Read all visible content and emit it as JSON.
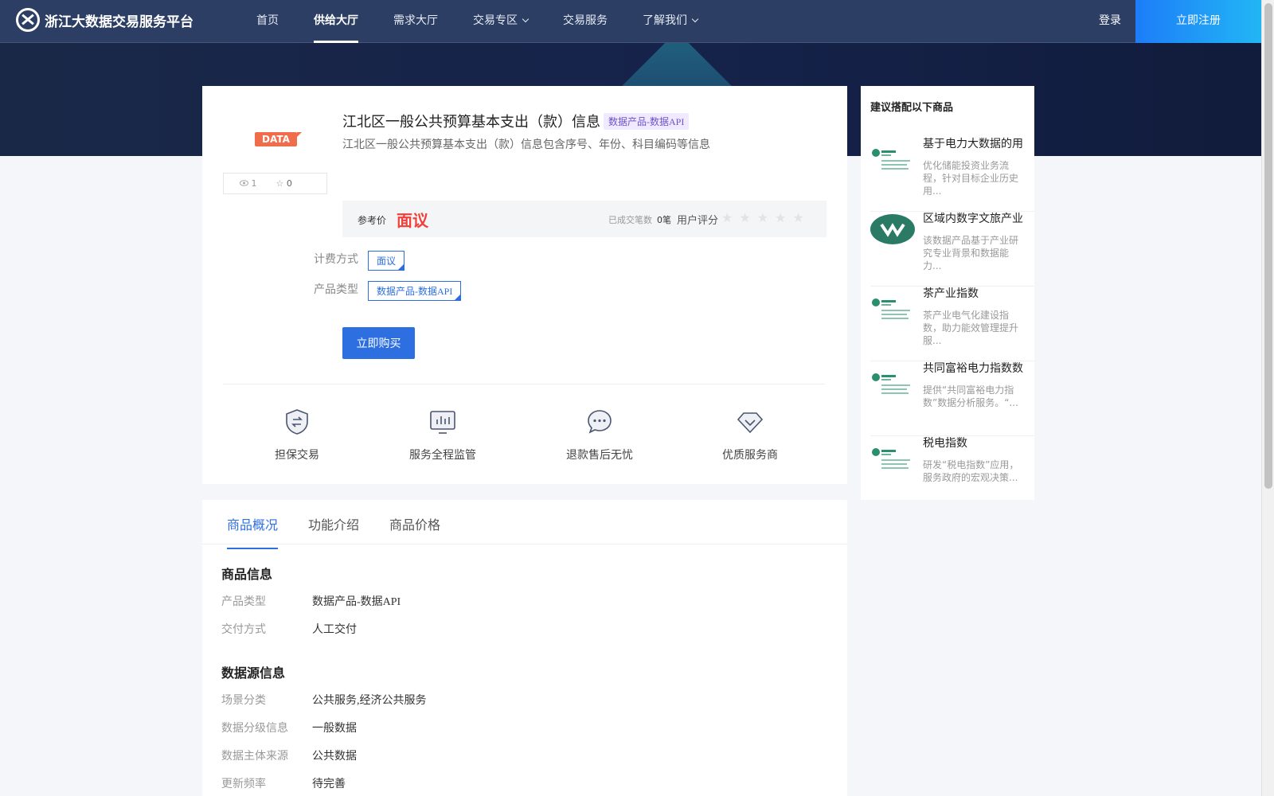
{
  "header": {
    "logo_text": "浙江大数据交易服务平台",
    "nav": [
      {
        "label": "首页"
      },
      {
        "label": "供给大厅"
      },
      {
        "label": "需求大厅"
      },
      {
        "label": "交易专区"
      },
      {
        "label": "交易服务"
      },
      {
        "label": "了解我们"
      }
    ],
    "login_label": "登录",
    "register_label": "立即注册"
  },
  "product": {
    "badge": "DATA",
    "views": "1",
    "favorites": "0",
    "title": "江北区一般公共预算基本支出（款）信息",
    "tag": "数据产品-数据API",
    "description": "江北区一般公共预算基本支出（款）信息包含序号、年份、科目编码等信息",
    "price_label": "参考价",
    "price_value": "面议",
    "deals_label": "已成交笔数",
    "deals_value": "0笔",
    "rating_label": "用户评分",
    "rating": 0,
    "billing_label": "计费方式",
    "billing_value": "面议",
    "type_label": "产品类型",
    "type_value": "数据产品-数据API",
    "buy_label": "立即购买"
  },
  "features": [
    {
      "label": "担保交易",
      "icon": "shield-exchange-icon"
    },
    {
      "label": "服务全程监管",
      "icon": "monitor-chart-icon"
    },
    {
      "label": "退款售后无忧",
      "icon": "chat-bubble-icon"
    },
    {
      "label": "优质服务商",
      "icon": "diamond-icon"
    }
  ],
  "sidebar": {
    "title": "建议搭配以下商品",
    "items": [
      {
        "name": "基于电力大数据的用",
        "desc": "优化储能投资业务流程，针对目标企业历史用..."
      },
      {
        "name": "区域内数字文旅产业",
        "desc": "该数据产品基于产业研究专业背景和数据能力..."
      },
      {
        "name": "茶产业指数",
        "desc": "茶产业电气化建设指数，助力能效管理提升服..."
      },
      {
        "name": "共同富裕电力指数数",
        "desc": "提供“共同富裕电力指数”数据分析服务。“..."
      },
      {
        "name": "税电指数",
        "desc": "研发“税电指数”应用，服务政府的宏观决策..."
      }
    ]
  },
  "tabs": [
    {
      "label": "商品概况"
    },
    {
      "label": "功能介绍"
    },
    {
      "label": "商品价格"
    }
  ],
  "details": {
    "goods_info_title": "商品信息",
    "goods_info": [
      {
        "label": "产品类型",
        "value": "数据产品-数据API"
      },
      {
        "label": "交付方式",
        "value": "人工交付"
      }
    ],
    "source_info_title": "数据源信息",
    "source_info": [
      {
        "label": "场景分类",
        "value": "公共服务,经济公共服务"
      },
      {
        "label": "数据分级信息",
        "value": "一般数据"
      },
      {
        "label": "数据主体来源",
        "value": "公共数据"
      },
      {
        "label": "更新频率",
        "value": "待完善"
      }
    ]
  },
  "colors": {
    "header_bg": "#2c3e63",
    "accent": "#2d6fe0",
    "price": "#f0403a",
    "badge": "#ef6d4a",
    "tag": "#6f52c9"
  }
}
